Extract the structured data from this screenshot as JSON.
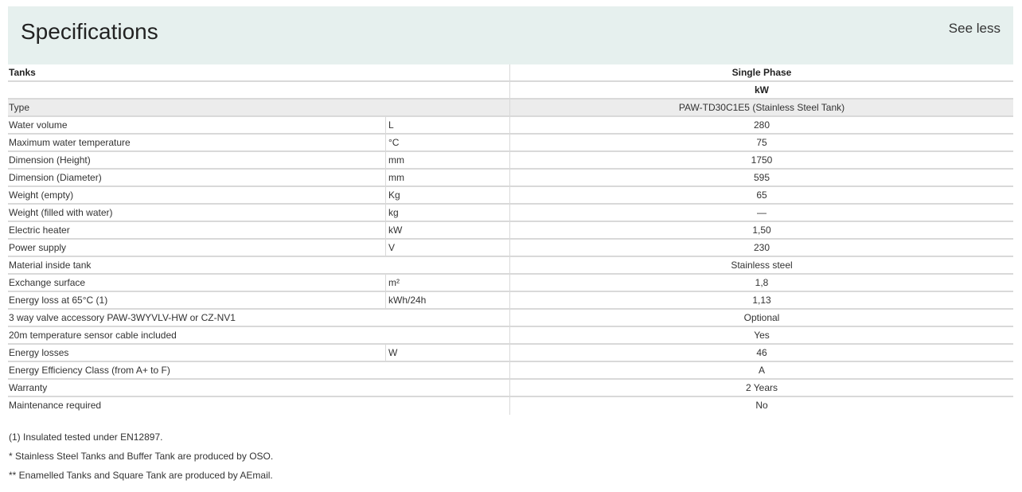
{
  "header": {
    "title": "Specifications",
    "toggle_label": "See less"
  },
  "table": {
    "head": {
      "label": "Tanks",
      "phase": "Single Phase",
      "unit_row_value": "kW"
    },
    "type_row": {
      "label": "Type",
      "value": "PAW-TD30C1E5 (Stainless Steel Tank)"
    },
    "rows": [
      {
        "label": "Water volume",
        "unit": "L",
        "value": "280"
      },
      {
        "label": "Maximum water temperature",
        "unit": "°C",
        "value": "75"
      },
      {
        "label": "Dimension (Height)",
        "unit": "mm",
        "value": "1750"
      },
      {
        "label": "Dimension (Diameter)",
        "unit": "mm",
        "value": "595"
      },
      {
        "label": "Weight (empty)",
        "unit": "Kg",
        "value": "65"
      },
      {
        "label": "Weight (filled with water)",
        "unit": "kg",
        "value": "—"
      },
      {
        "label": "Electric heater",
        "unit": "kW",
        "value": "1,50"
      },
      {
        "label": "Power supply",
        "unit": "V",
        "value": "230"
      },
      {
        "label": "Material inside tank",
        "unit": "",
        "value": "Stainless steel"
      },
      {
        "label": "Exchange surface",
        "unit": "m²",
        "value": "1,8"
      },
      {
        "label": "Energy loss at 65°C (1)",
        "unit": "kWh/24h",
        "value": "1,13"
      },
      {
        "label": "3 way valve accessory PAW-3WYVLV-HW or CZ-NV1",
        "unit": "",
        "value": "Optional"
      },
      {
        "label": "20m temperature sensor cable included",
        "unit": "",
        "value": "Yes"
      },
      {
        "label": "Energy losses",
        "unit": "W",
        "value": "46"
      },
      {
        "label": "Energy Efficiency Class (from A+ to F)",
        "unit": "",
        "value": "A"
      },
      {
        "label": "Warranty",
        "unit": "",
        "value": "2 Years"
      },
      {
        "label": "Maintenance required",
        "unit": "",
        "value": "No"
      }
    ]
  },
  "notes": [
    "(1) Insulated tested under EN12897.",
    "* Stainless Steel Tanks and Buffer Tank are produced by OSO.",
    "** Enamelled Tanks and Square Tank are produced by AEmail."
  ]
}
